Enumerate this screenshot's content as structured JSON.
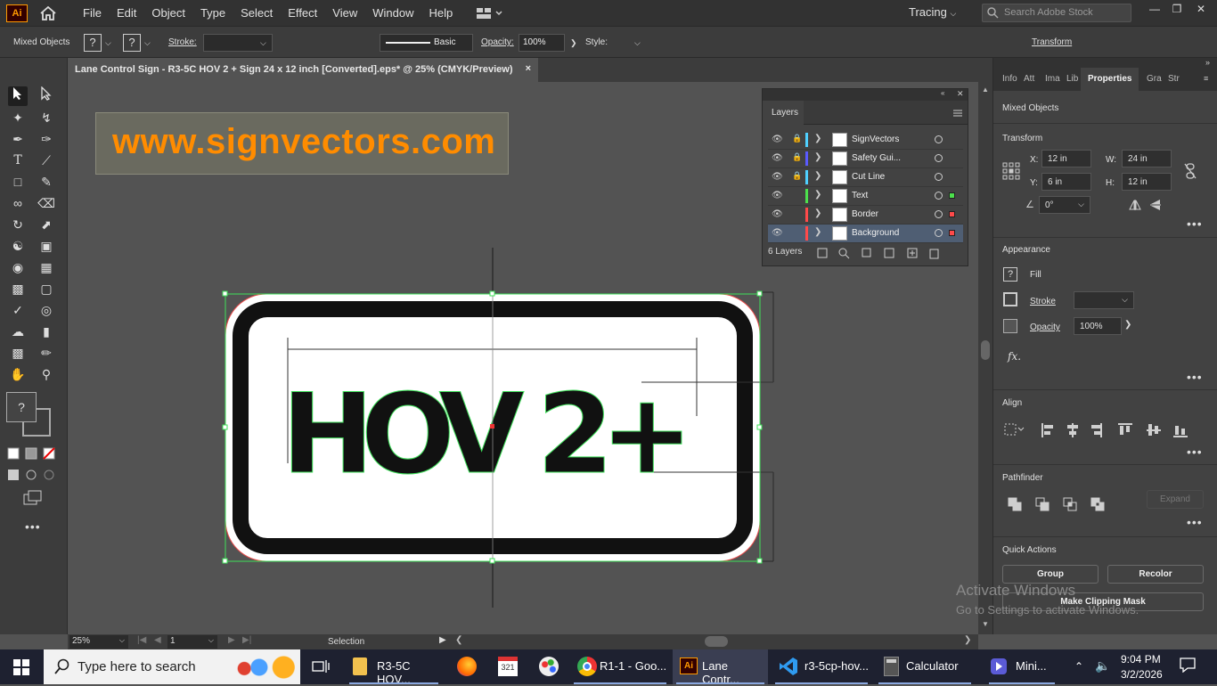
{
  "app": {
    "logo": "Ai",
    "menu": [
      "File",
      "Edit",
      "Object",
      "Type",
      "Select",
      "Effect",
      "View",
      "Window",
      "Help"
    ],
    "workspace": "Tracing",
    "search_placeholder": "Search Adobe Stock"
  },
  "control_bar": {
    "selection_label": "Mixed Objects",
    "question_mark": "?",
    "stroke_label": "Stroke:",
    "brush_label": "Basic",
    "opacity_label": "Opacity:",
    "opacity_value": "100%",
    "style_label": "Style:",
    "transform_label": "Transform"
  },
  "document": {
    "tab_title": "Lane Control Sign - R3-5C HOV 2 + Sign 24 x 12 inch [Converted].eps* @ 25% (CMYK/Preview)",
    "close": "×",
    "watermark": "www.signvectors.com",
    "sign_text": "HOV 2+"
  },
  "layers_panel": {
    "tab": "Layers",
    "rows": [
      {
        "name": "SignVectors",
        "color": "#4fd0ff",
        "locked": true,
        "target_color": ""
      },
      {
        "name": "Safety Gui...",
        "color": "#5a5aff",
        "locked": true,
        "target_color": ""
      },
      {
        "name": "Cut Line",
        "color": "#4fd0ff",
        "locked": true,
        "target_color": ""
      },
      {
        "name": "Text",
        "color": "#4ce04c",
        "locked": false,
        "target_color": "#4ce04c"
      },
      {
        "name": "Border",
        "color": "#ff4a4a",
        "locked": false,
        "target_color": "#ff4a4a"
      },
      {
        "name": "Background",
        "color": "#ff4a4a",
        "locked": false,
        "target_color": "#ff4a4a",
        "selected": true
      }
    ],
    "count": "6 Layers"
  },
  "properties": {
    "tabs": [
      "Info",
      "Att",
      "Ima",
      "Lib",
      "Properties",
      "Gra",
      "Str"
    ],
    "active_tab": "Properties",
    "selection": "Mixed Objects",
    "transform": {
      "header": "Transform",
      "x_label": "X:",
      "x": "12 in",
      "y_label": "Y:",
      "y": "6 in",
      "w_label": "W:",
      "w": "24 in",
      "h_label": "H:",
      "h": "12 in",
      "angle": "0°"
    },
    "appearance": {
      "header": "Appearance",
      "fill": "Fill",
      "stroke": "Stroke",
      "opacity": "Opacity",
      "opacity_value": "100%",
      "fx": "fx."
    },
    "align_header": "Align",
    "pathfinder_header": "Pathfinder",
    "expand": "Expand",
    "quick_actions": {
      "header": "Quick Actions",
      "group": "Group",
      "recolor": "Recolor",
      "clip": "Make Clipping Mask"
    }
  },
  "status": {
    "zoom": "25%",
    "artboard": "1",
    "tool": "Selection"
  },
  "watermark_os": {
    "line1": "Activate Windows",
    "line2": "Go to Settings to activate Windows."
  },
  "taskbar": {
    "search": "Type here to search",
    "items": [
      "R3-5C HOV...",
      "R1-1 - Goo...",
      "Lane Contr...",
      "r3-5cp-hov...",
      "Calculator",
      "Mini..."
    ],
    "time": "9:04 PM",
    "date": "3/2/2026"
  }
}
